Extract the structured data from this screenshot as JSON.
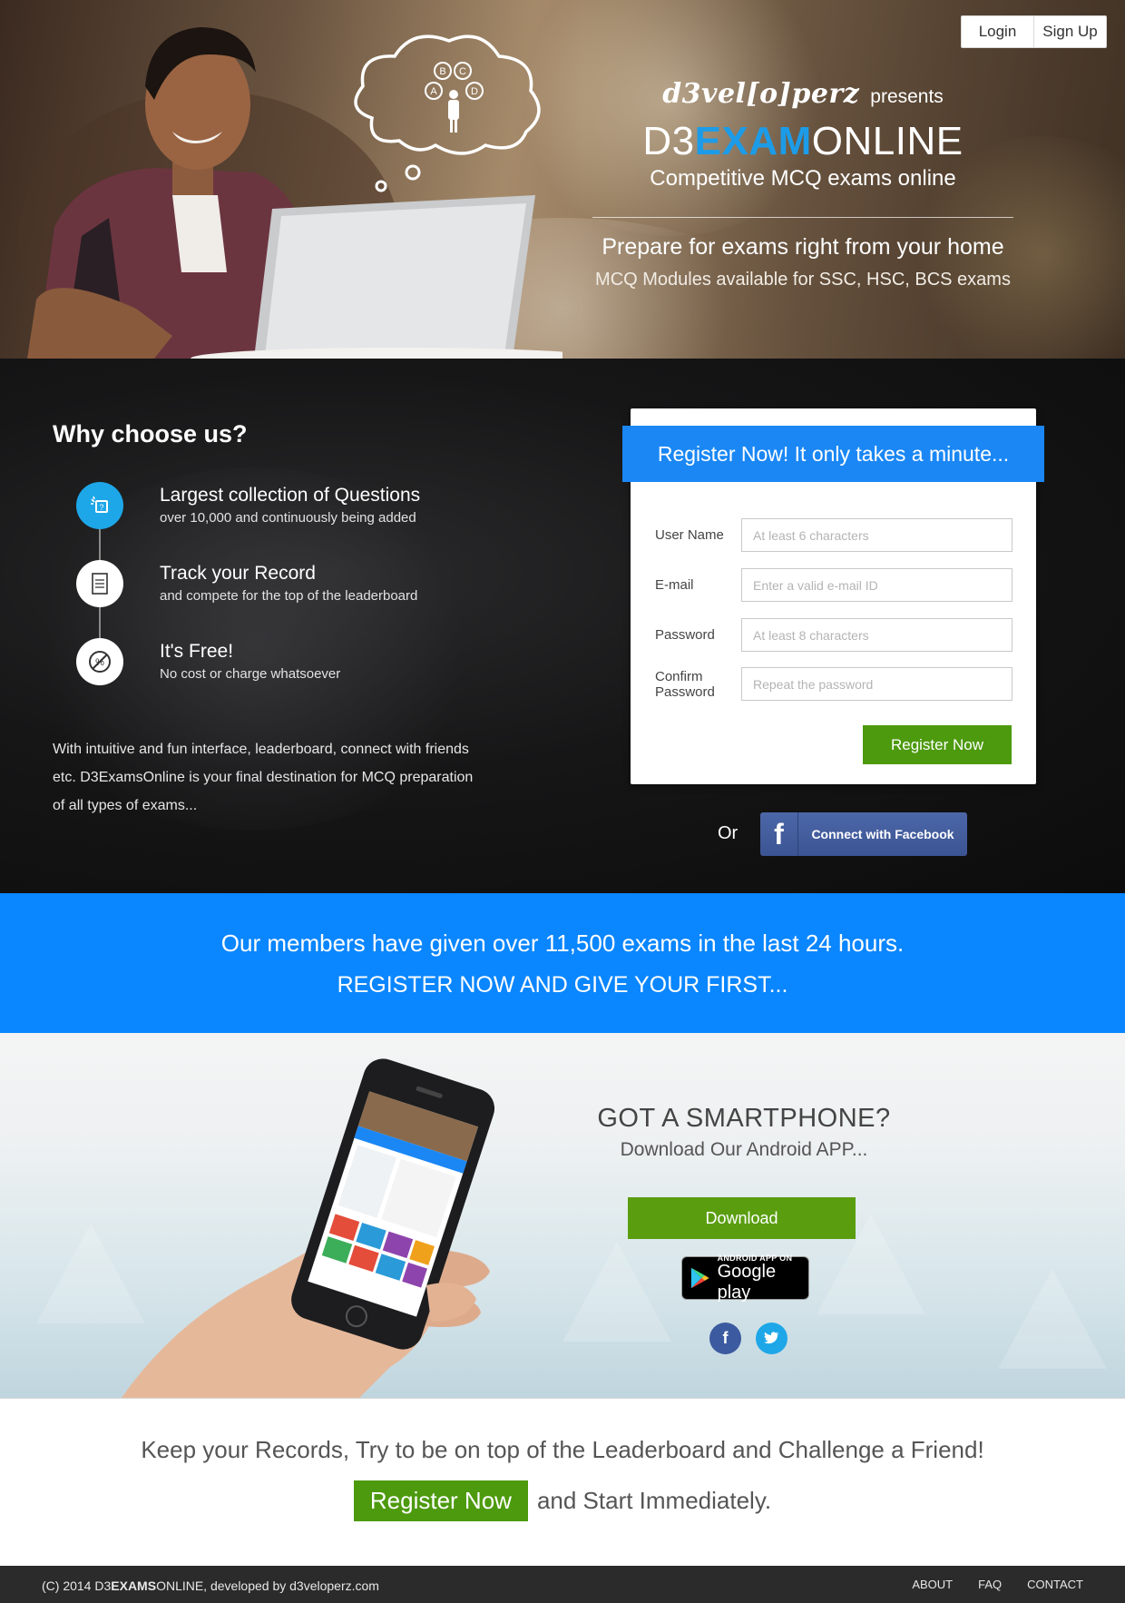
{
  "header": {
    "login_label": "Login",
    "signup_label": "Sign Up",
    "brand_logo": "d3vel[o]perz",
    "presents": "presents",
    "site_title_pre": "D3",
    "site_title_accent": "EXAM",
    "site_title_post": "ONLINE",
    "tagline": "Competitive MCQ exams online",
    "lead": "Prepare for exams right from your home",
    "sublead": "MCQ Modules available for SSC, HSC, BCS exams",
    "thought_options": [
      "B",
      "C",
      "A",
      "D"
    ]
  },
  "why": {
    "title": "Why choose us?",
    "features": [
      {
        "title": "Largest collection of Questions",
        "desc": "over 10,000 and continuously being added",
        "icon": "question-collection-icon"
      },
      {
        "title": "Track your Record",
        "desc": "and compete for the top of the leaderboard",
        "icon": "record-document-icon"
      },
      {
        "title": "It's Free!",
        "desc": "No cost or charge whatsoever",
        "icon": "no-cost-icon"
      }
    ],
    "paragraph": "With intuitive and fun interface, leaderboard, connect with friends etc. D3ExamsOnline is your final destination for MCQ preparation of all types of exams..."
  },
  "register": {
    "heading": "Register Now! It only takes a minute...",
    "fields": [
      {
        "label": "User Name",
        "placeholder": "At least 6 characters",
        "value": ""
      },
      {
        "label": "E-mail",
        "placeholder": "Enter a valid e-mail ID",
        "value": ""
      },
      {
        "label": "Password",
        "placeholder": "At least 8 characters",
        "value": ""
      },
      {
        "label": "Confirm Password",
        "placeholder": "Repeat the password",
        "value": ""
      }
    ],
    "submit_label": "Register Now",
    "or_label": "Or",
    "facebook_label": "Connect with Facebook"
  },
  "banner": {
    "line1": "Our members have given over 11,500 exams in the last 24 hours.",
    "line2": "REGISTER NOW AND GIVE YOUR FIRST..."
  },
  "app": {
    "question": "GOT A SMARTPHONE?",
    "subtitle": "Download Our Android APP...",
    "download_label": "Download",
    "badge_small": "ANDROID APP ON",
    "badge_big": "Google play"
  },
  "cta": {
    "line1": "Keep your Records, Try to be on top of the Leaderboard and Challenge a Friend!",
    "button_label": "Register Now",
    "after_text": "and Start Immediately."
  },
  "footer": {
    "copyright_pre": "(C) 2014 D3",
    "copyright_bold": "EXAMS",
    "copyright_post": "ONLINE, developed by d3veloperz.com",
    "links": [
      "ABOUT",
      "FAQ",
      "CONTACT"
    ]
  },
  "colors": {
    "accent_blue": "#1a87f5",
    "banner_blue": "#0a86ff",
    "green": "#4d9a0e",
    "facebook": "#3b5493"
  }
}
